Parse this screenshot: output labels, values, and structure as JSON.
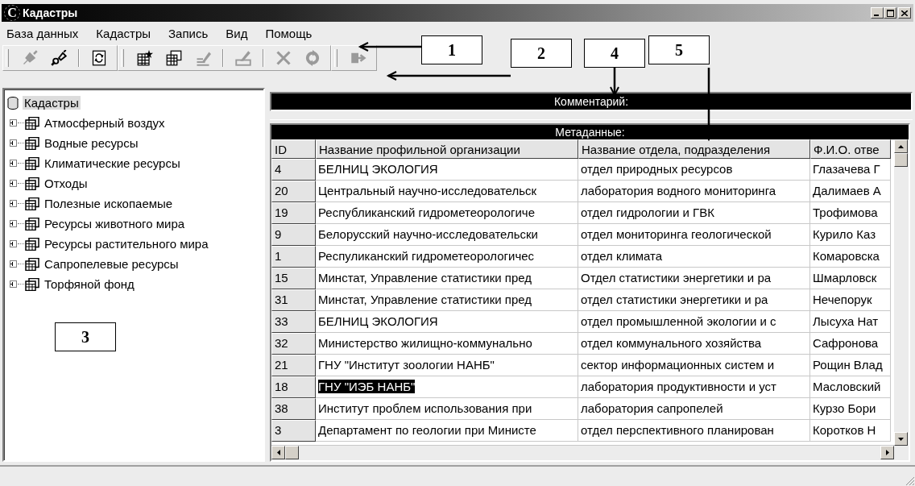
{
  "window": {
    "logo": "C",
    "title": "Кадастры"
  },
  "menu": [
    "База данных",
    "Кадастры",
    "Запись",
    "Вид",
    "Помощь"
  ],
  "toolbar": {
    "groups": [
      {
        "items": [
          {
            "kind": "plug",
            "disabled": true
          },
          {
            "kind": "unplug",
            "disabled": false
          },
          {
            "kind": "separator"
          },
          {
            "kind": "refresh",
            "disabled": false
          }
        ]
      },
      {
        "items": [
          {
            "kind": "new-table",
            "disabled": false
          },
          {
            "kind": "copy-table",
            "disabled": false
          },
          {
            "kind": "edit",
            "disabled": true
          },
          {
            "kind": "separator"
          },
          {
            "kind": "edit-row",
            "disabled": true
          },
          {
            "kind": "separator"
          },
          {
            "kind": "delete",
            "disabled": true
          },
          {
            "kind": "reload",
            "disabled": true
          }
        ]
      },
      {
        "items": [
          {
            "kind": "exit",
            "disabled": true
          }
        ]
      }
    ]
  },
  "tree": {
    "root": {
      "label": "Кадастры",
      "selected": true,
      "children": [
        {
          "label": "Атмосферный воздух",
          "expanded": false
        },
        {
          "label": "Водные ресурсы",
          "expanded": false
        },
        {
          "label": "Климатические ресурсы",
          "expanded": false
        },
        {
          "label": "Отходы",
          "expanded": false
        },
        {
          "label": "Полезные ископаемые",
          "expanded": false
        },
        {
          "label": "Ресурсы животного мира",
          "expanded": false
        },
        {
          "label": "Ресурсы растительного мира",
          "expanded": false
        },
        {
          "label": "Сапропелевые ресурсы",
          "expanded": false
        },
        {
          "label": "Торфяной фонд",
          "expanded": false
        }
      ]
    }
  },
  "comment": {
    "title": "Комментарий:"
  },
  "grid": {
    "title": "Метаданные:",
    "columns": [
      "ID",
      "Название профильной организации",
      "Название отдела, подразделения",
      "Ф.И.О. отве"
    ],
    "rows": [
      {
        "cells": [
          "4",
          "БЕЛНИЦ ЭКОЛОГИЯ",
          "отдел природных ресурсов",
          "Глазачева Г"
        ],
        "selected": false
      },
      {
        "cells": [
          "20",
          "Центральный научно-исследовательск",
          "лаборатория водного мониторинга",
          "Далимаев А"
        ],
        "selected": false
      },
      {
        "cells": [
          "19",
          "Республиканский гидрометеорологиче",
          "отдел гидрологии и ГВК",
          "Трофимова"
        ],
        "selected": false
      },
      {
        "cells": [
          "9",
          "Белорусский научно-исследовательски",
          "отдел мониторинга геологической",
          "Курило Каз"
        ],
        "selected": false
      },
      {
        "cells": [
          "1",
          "Респуликанский гидрометеорологичес",
          "отдел климата",
          "Комаровска"
        ],
        "selected": false
      },
      {
        "cells": [
          "15",
          "Минстат, Управление статистики пред",
          "Отдел статистики энергетики и ра",
          "Шмарловск"
        ],
        "selected": false
      },
      {
        "cells": [
          "31",
          "Минстат, Управление статистики пред",
          "отдел статистики энергетики и ра",
          "Нечепорук"
        ],
        "selected": false
      },
      {
        "cells": [
          "33",
          "БЕЛНИЦ ЭКОЛОГИЯ",
          "отдел промышленной экологии и с",
          "Лысуха Нат"
        ],
        "selected": false
      },
      {
        "cells": [
          "32",
          "Министерство жилищно-коммунально",
          "отдел коммунального хозяйства",
          "Сафронова"
        ],
        "selected": false
      },
      {
        "cells": [
          "21",
          "ГНУ \"Институт зоологии НАНБ\"",
          "сектор информационных систем и",
          "Рощин Влад"
        ],
        "selected": false
      },
      {
        "cells": [
          "18",
          "ГНУ \"ИЭБ НАНБ\"",
          "лаборатория продуктивности и уст",
          "Масловский"
        ],
        "selected": true
      },
      {
        "cells": [
          "38",
          "Институт проблем использования при",
          "лаборатория сапропелей",
          "Курзо Бори"
        ],
        "selected": false
      },
      {
        "cells": [
          "3",
          "Департамент по геологии при Министе",
          "отдел перспективного планирован",
          "Коротков Н"
        ],
        "selected": false
      }
    ]
  },
  "callouts": [
    {
      "label": "1"
    },
    {
      "label": "2"
    },
    {
      "label": "3"
    },
    {
      "label": "4"
    },
    {
      "label": "5"
    }
  ]
}
